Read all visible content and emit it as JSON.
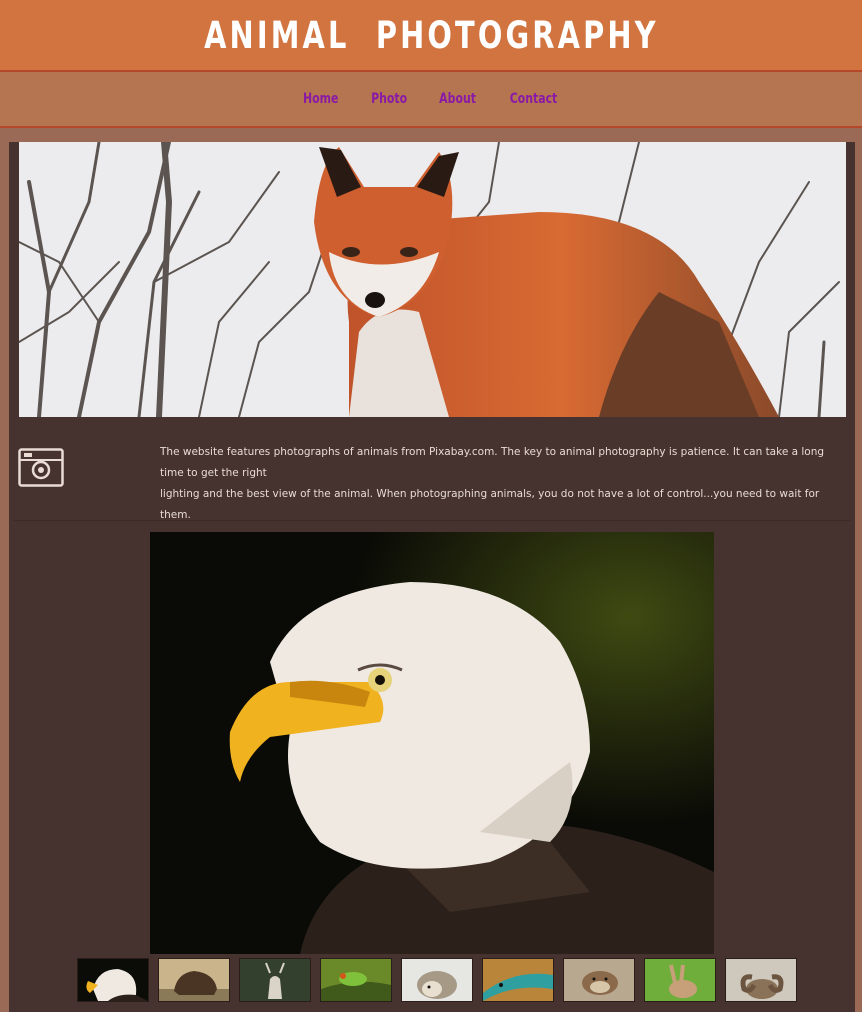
{
  "site": {
    "title": "ANIMAL  PHOTOGRAPHY"
  },
  "nav": {
    "items": [
      {
        "label": "Home"
      },
      {
        "label": "Photo"
      },
      {
        "label": "About"
      },
      {
        "label": "Contact"
      }
    ]
  },
  "hero": {
    "image": "red fox standing in snow with bare branches"
  },
  "intro": {
    "icon": "camera-icon",
    "line1": "The website features photographs of animals from Pixabay.com. The key to animal photography is patience. It can take a long time to get the right",
    "line2": "lighting and the best view of the animal. When photographing animals, you do not have a lot of control...you need to wait for them."
  },
  "gallery": {
    "main_image": "bald eagle portrait",
    "thumbnails": [
      "eagle",
      "bison",
      "deer",
      "frog",
      "hedgehog",
      "lizard",
      "otter",
      "rabbit",
      "ram"
    ]
  },
  "colors": {
    "header": "#d17440",
    "nav": "#b57550",
    "panel": "#46322e",
    "background": "#9b6a56",
    "nav_link": "#8a1aa6"
  }
}
